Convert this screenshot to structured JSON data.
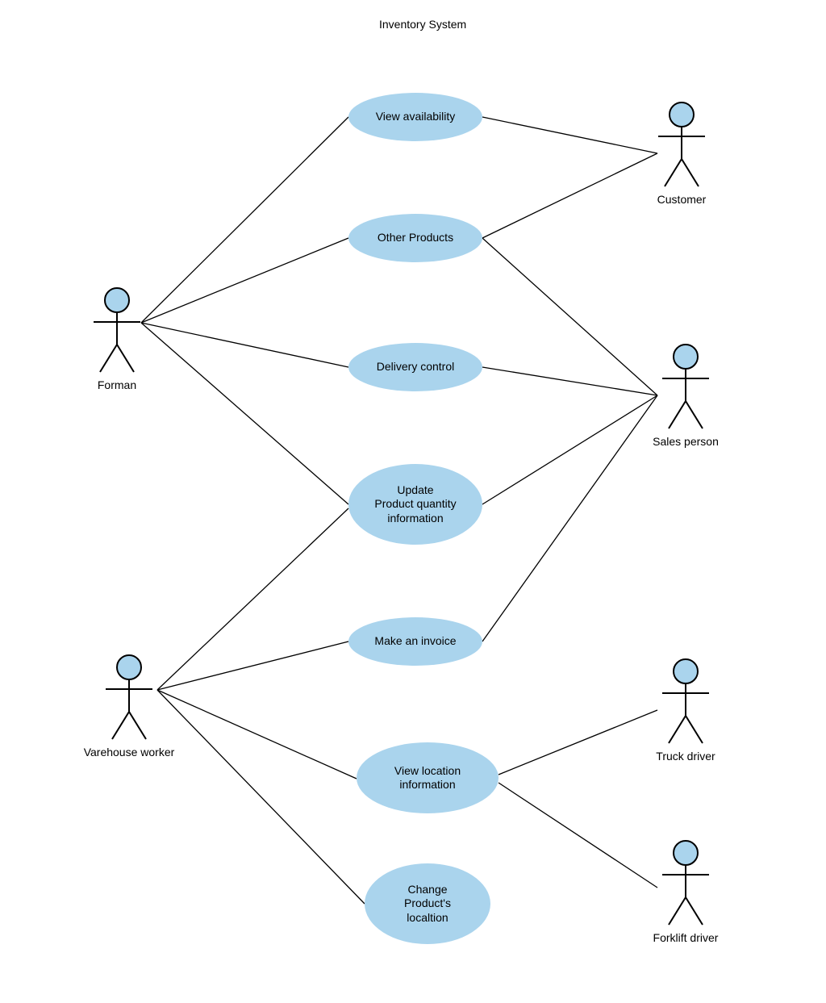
{
  "title": "Inventory System",
  "actors": {
    "forman": {
      "label": "Forman"
    },
    "varehouse": {
      "label": "Varehouse worker"
    },
    "customer": {
      "label": "Customer"
    },
    "sales": {
      "label": "Sales person"
    },
    "truck": {
      "label": "Truck driver"
    },
    "forklift": {
      "label": "Forklift driver"
    }
  },
  "usecases": {
    "view_avail": {
      "label": "View availability"
    },
    "other_prod": {
      "label": "Other Products"
    },
    "delivery": {
      "label": "Delivery control"
    },
    "update_qty": {
      "label": "Update\nProduct quantity\ninformation"
    },
    "make_invoice": {
      "label": "Make an invoice"
    },
    "view_loc": {
      "label": "View location\ninformation"
    },
    "change_loc": {
      "label": "Change\nProduct's\nlocaltion"
    }
  }
}
